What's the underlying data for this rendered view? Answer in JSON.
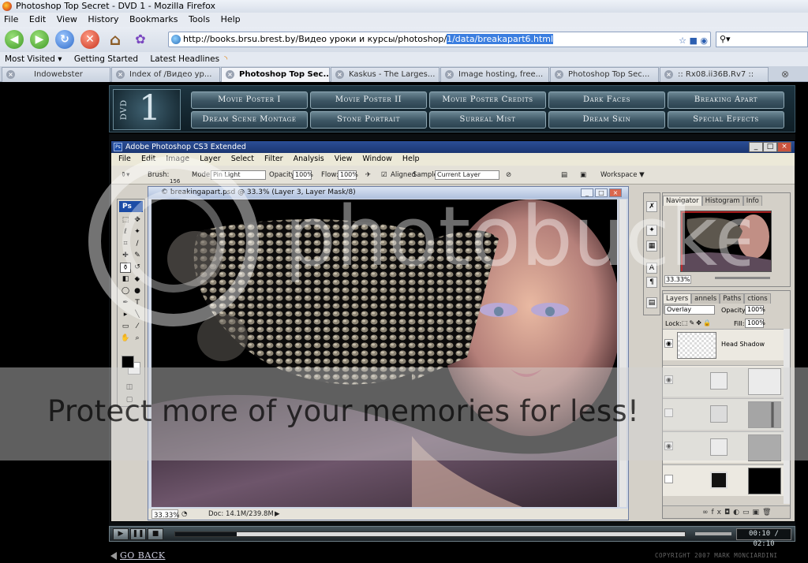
{
  "browser": {
    "title": "Photoshop Top Secret - DVD 1 - Mozilla Firefox",
    "menu": [
      "File",
      "Edit",
      "View",
      "History",
      "Bookmarks",
      "Tools",
      "Help"
    ],
    "url_prefix": "http://books.brsu.brest.by/Видео уроки и курсы/photoshop/",
    "url_selected": "1/data/breakapart6.html",
    "bookmarks": [
      "Most Visited ▾",
      "Getting Started",
      "Latest Headlines"
    ],
    "tabs": [
      "Indowebster",
      "Index of /Видео ур...",
      "Photoshop Top Sec...",
      "Kaskus - The Larges...",
      "Image hosting, free...",
      "Photoshop Top Sec...",
      ":: Rx08.ii36B.Rv7 ::"
    ]
  },
  "dvd": {
    "logo_label": "DVD",
    "logo_number": "1",
    "menu_row1": [
      "Movie Poster I",
      "Movie Poster II",
      "Movie Poster Credits",
      "Dark Faces",
      "Breaking Apart"
    ],
    "menu_row2": [
      "Dream Scene Montage",
      "Stone Portrait",
      "Surreal Mist",
      "Dream Skin",
      "Special Effects"
    ],
    "time": "00:10 / 02:10",
    "progress_fraction": 0.12,
    "go_back": "GO BACK",
    "copyright": "COPYRIGHT 2007 MARK MONCIARDINI"
  },
  "photoshop": {
    "title": "Adobe Photoshop CS3 Extended",
    "menu": [
      "File",
      "Edit",
      "Image",
      "Layer",
      "Select",
      "Filter",
      "Analysis",
      "View",
      "Window",
      "Help"
    ],
    "options": {
      "brush_label": "Brush:",
      "brush_size": "156",
      "mode_label": "Mode:",
      "mode_value": "Pin Light",
      "opacity_label": "Opacity:",
      "opacity_value": "100%",
      "flow_label": "Flow:",
      "flow_value": "100%",
      "aligned_label": "Aligned",
      "sample_label": "Sample:",
      "sample_value": "Current Layer",
      "workspace_label": "Workspace ▼"
    },
    "doc_title": "© breakingapart.psd @ 33.3% (Layer 3, Layer Mask/8)",
    "doc_zoom": "33.33%",
    "doc_size": "Doc: 14.1M/239.8M",
    "navigator": {
      "tabs": [
        "Navigator",
        "Histogram",
        "Info"
      ],
      "zoom": "33.33%"
    },
    "layers": {
      "tabs": [
        "Layers",
        "annels",
        "Paths",
        "ctions",
        "istory"
      ],
      "blend_mode": "Overlay",
      "opacity_label": "Opacity:",
      "opacity_value": "100%",
      "lock_label": "Lock:",
      "fill_label": "Fill:",
      "fill_value": "100%",
      "top_layer_name": "Head Shadow"
    }
  },
  "watermark": {
    "logo_text": "photobucket",
    "tagline": "Protect more of your memories for less!"
  }
}
